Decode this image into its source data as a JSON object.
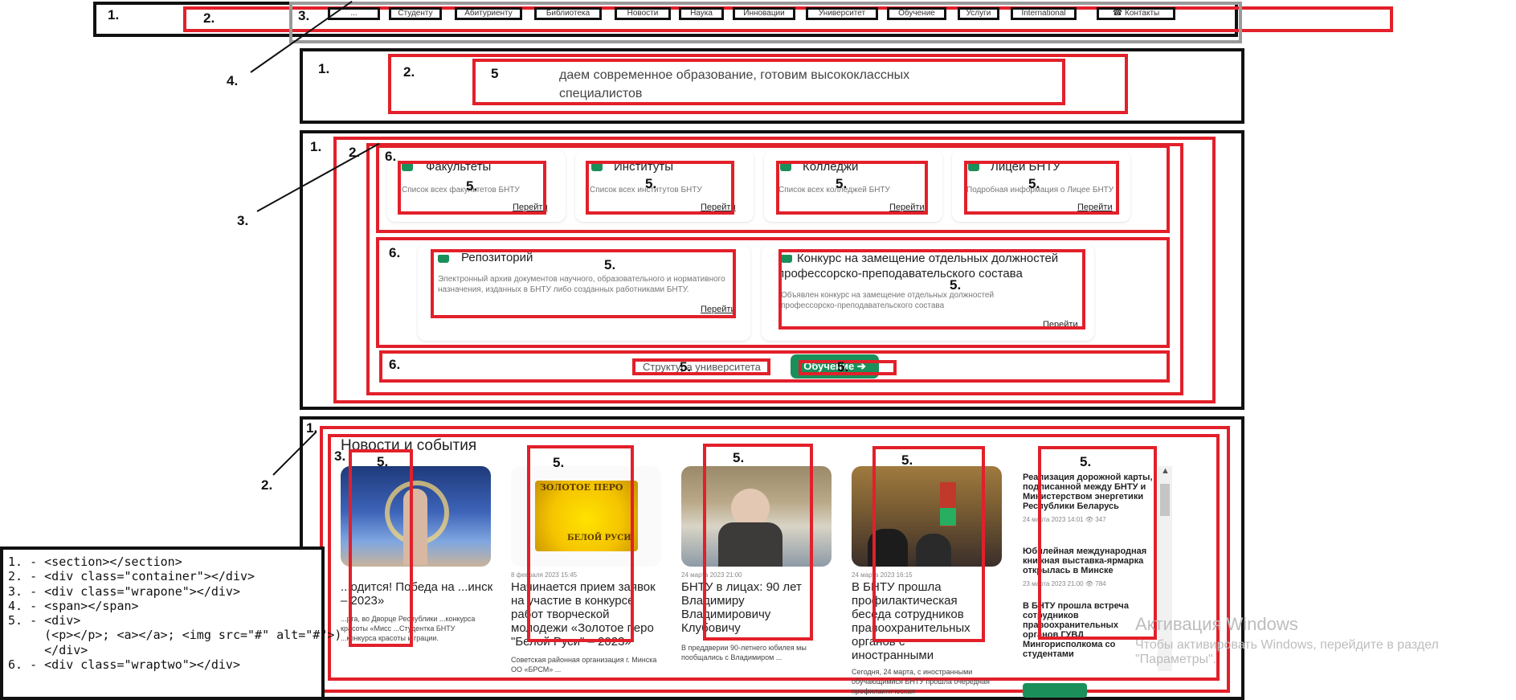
{
  "nav": {
    "items": [
      "...",
      "Студенту",
      "Абитуриенту",
      "Библиотека",
      "Новости",
      "Наука",
      "Инновации",
      "Университет",
      "Обучение",
      "Услуги",
      "International",
      "Контакты"
    ]
  },
  "hero": {
    "text_line1": "даем современное образование, готовим высококлассных",
    "text_line2": "специалистов"
  },
  "cards_row1": [
    {
      "title": "Факультеты",
      "desc": "Список всех факультетов БНТУ",
      "link": "Перейти"
    },
    {
      "title": "Институты",
      "desc": "Список всех институтов БНТУ",
      "link": "Перейти"
    },
    {
      "title": "Колледжи",
      "desc": "Список всех колледжей БНТУ",
      "link": "Перейти"
    },
    {
      "title": "Лицей БНТУ",
      "desc": "Подробная информация о Лицее БНТУ",
      "link": "Перейти"
    }
  ],
  "cards_row2": [
    {
      "title": "Репозиторий",
      "desc": "Электронный архив документов научного, образовательного и нормативного назначения, изданных в БНТУ либо созданных работниками БНТУ.",
      "link": "Перейти"
    },
    {
      "title": "Конкурс на замещение отдельных должностей профессорско-преподавательского состава",
      "desc": "Объявлен конкурс на замещение отдельных должностей профессорско-преподавательского состава",
      "link": "Перейти"
    }
  ],
  "structure_link": "Структура университета",
  "study_button": "Обучение",
  "news": {
    "heading": "Новости и события",
    "items": [
      {
        "title": "...одится! Победа на ...инск – 2023»",
        "text": "...рта, во Дворце Республики ...конкурса красоты «Мисс ...Студентка БНТУ ...конкурса красоты и грации."
      },
      {
        "date": "8 февраля 2023 15:45",
        "title": "Начинается прием заявок на участие в конкурсе работ творческой молодежи «Золотое перо \"Белой Руси\" – 2023»",
        "text": "Советская районная организация г. Минска ОО «БРСМ» ..."
      },
      {
        "date": "24 марта 2023 21:00",
        "title": "БНТУ в лицах: 90 лет Владимиру Владимировичу Клубовичу",
        "text": "В преддверии 90-летнего юбилея мы пообщались с Владимиром ..."
      },
      {
        "date": "24 марта 2023 16:15",
        "title": "В БНТУ прошла профилактическая беседа сотрудников правоохранительных органов с иностранными студентами",
        "text": "Сегодня, 24 марта, с иностранными обучающимися БНТУ прошла очередная профилактическая"
      }
    ],
    "side_list": [
      {
        "title": "Реализация дорожной карты, подписанной между БНТУ и Министерством энергетики Республики Беларусь",
        "date": "24 марта 2023 14:01",
        "views": "347"
      },
      {
        "title": "Юбилейная международная книжная выставка-ярмарка открылась в Минске",
        "date": "23 марта 2023 21:00",
        "views": "784"
      },
      {
        "title": "В БНТУ прошла встреча сотрудников правоохранительных органов ГУВД Мингорисполкома со студентами",
        "date": "",
        "views": ""
      }
    ]
  },
  "annotations": {
    "numbers": [
      "1.",
      "2.",
      "3.",
      "4.",
      "5",
      "6."
    ]
  },
  "legend": {
    "lines": [
      "1. - <section></section>",
      "2. - <div class=\"container\"></div>",
      "3. - <div class=\"wrapone\"></div>",
      "4. - <span></span>",
      "5. - <div>",
      "     (<p></p>; <a></a>; <img src=\"#\" alt=\"#\">)",
      "     </div>",
      "6. - <div class=\"wraptwo\"></div>"
    ]
  },
  "watermark": {
    "title": "Активация Windows",
    "text": "Чтобы активировать Windows, перейдите в раздел",
    "text2": "\"Параметры\"."
  },
  "colors": {
    "annotation_red": "#e2202a",
    "annotation_black": "#111111",
    "brand_green": "#1b8f5a"
  }
}
